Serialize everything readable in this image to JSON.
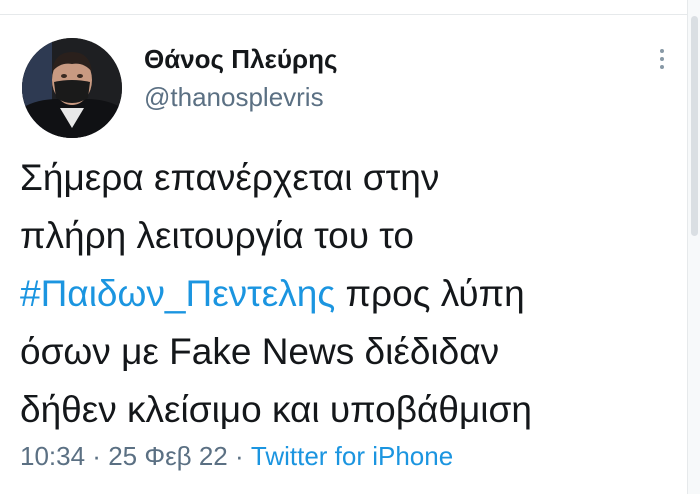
{
  "user": {
    "display_name": "Θάνος Πλεύρης",
    "handle": "@thanosplevris"
  },
  "tweet": {
    "line1": "Σήμερα επανέρχεται στην",
    "line2": "πλήρη λειτουργία του το",
    "hashtag": "#Παιδων_Πεντελης",
    "line3_rest": " προς λύπη",
    "line4": "όσων με Fake News διέδιδαν",
    "line5": "δήθεν κλείσιμο και υποβάθμιση"
  },
  "meta": {
    "time": "10:34",
    "date": "25 Φεβ 22",
    "separator": " · ",
    "source": "Twitter for iPhone"
  },
  "colors": {
    "link": "#1b95e0",
    "text": "#14171a",
    "secondary": "#5b7083"
  },
  "icons": {
    "more": "more-vertical-icon"
  }
}
